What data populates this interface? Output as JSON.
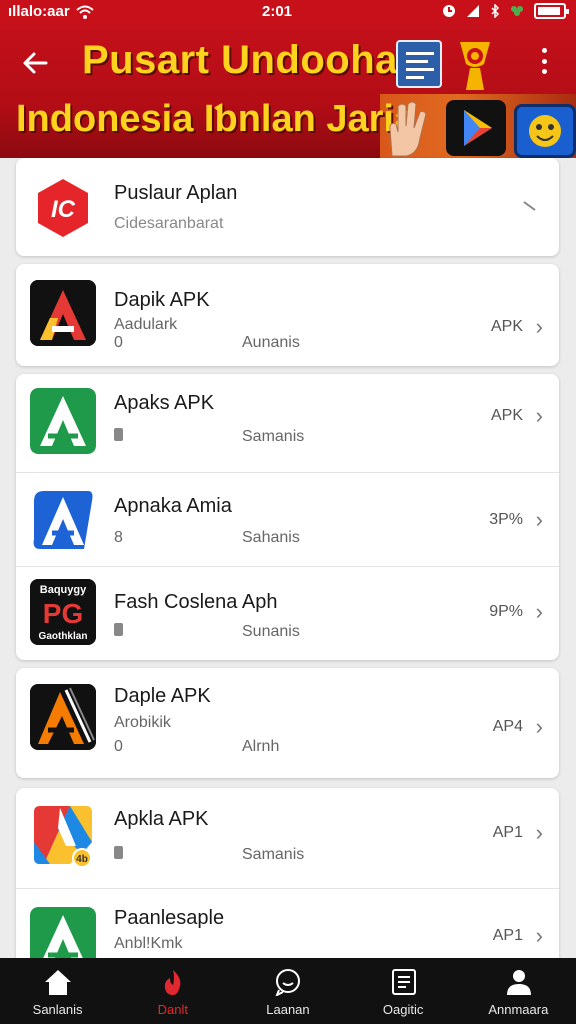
{
  "status_bar": {
    "carrier": "ıllalo:aar",
    "time": "2:01"
  },
  "header": {
    "title_line1": "Pusart Undoohan",
    "title_line2": "Indonesia Iƅnlan Jaria"
  },
  "featured": {
    "icon_text": "IC",
    "name": "Puslaur Aplan",
    "subtitle": "Cidesaranbarat"
  },
  "apps": [
    {
      "name": "Dapik APK",
      "sub": "Aadulark",
      "meta": "0",
      "status": "Aunanis",
      "badge": "APK",
      "colors": [
        "#111111",
        "#e53935",
        "#fbc02d"
      ]
    },
    {
      "name": "Apaks APK",
      "sub": "",
      "meta": "trash",
      "status": "Samanis",
      "badge": "APK",
      "colors": [
        "#1e9a4a"
      ]
    },
    {
      "name": "Apnaka Amia",
      "sub": "",
      "meta": "8",
      "status": "Sahanis",
      "badge": "3P%",
      "colors": [
        "#1e63d6"
      ]
    },
    {
      "name": "Fash Coslena Aph",
      "sub": "",
      "meta": "trash",
      "status": "Sunanis",
      "badge": "9P%",
      "icon_top": "Baquygy",
      "icon_mid": "PG",
      "icon_bot": "Gaothklan",
      "colors": [
        "#111111",
        "#e53935"
      ]
    },
    {
      "name": "Daple APK",
      "sub": "Arobikik",
      "meta": "0",
      "status": "Alrnh",
      "badge": "AP4",
      "colors": [
        "#111111",
        "#f57c00"
      ]
    },
    {
      "name": "Apkla APK",
      "sub": "",
      "meta": "trash",
      "status": "Samanis",
      "badge": "AP1",
      "icon_badge": "4b",
      "colors": [
        "#e53935",
        "#1e88e5",
        "#fbc02d",
        "#43a047"
      ]
    },
    {
      "name": "Paanlesaple",
      "sub": "Anbl!Kmk",
      "meta": "",
      "status": "",
      "badge": "AP1",
      "colors": [
        "#1e9a4a"
      ]
    }
  ],
  "bottom_nav": [
    {
      "label": "Sanlanis",
      "icon": "home-icon",
      "active": false
    },
    {
      "label": "Danlt",
      "icon": "flame-icon",
      "active": true
    },
    {
      "label": "Laanan",
      "icon": "chat-icon",
      "active": false
    },
    {
      "label": "Oagitic",
      "icon": "list-icon",
      "active": false
    },
    {
      "label": "Annmaara",
      "icon": "profile-icon",
      "active": false
    }
  ]
}
